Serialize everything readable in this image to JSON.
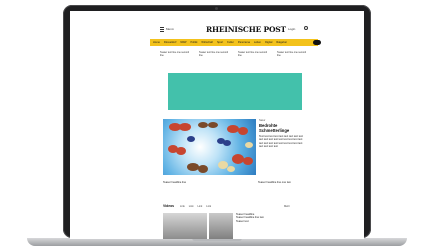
{
  "header": {
    "menu_label": "Menü",
    "logo": "RHEINISCHE POST",
    "login_label": "Login"
  },
  "nav": {
    "items": [
      "Home",
      "Düsseldorf",
      "NRW",
      "Politik",
      "Wirtschaft",
      "Sport",
      "Kultur",
      "Panorama",
      "Leben",
      "Digital",
      "Ratgeber"
    ]
  },
  "teasers": [
    "Teaser text line one second line",
    "Teaser text line one second line",
    "Teaser text line one second line",
    "Teaser text line one second line"
  ],
  "hero": {
    "kicker": "Natur",
    "title": "Bedrohte Schmetterlinge",
    "body": "Text text text text text text text text text text text text text text text text text text text text text text text text text text text text text text text"
  },
  "row_teasers": [
    "Teaser headline line",
    "Teaser headline line one two"
  ],
  "section": {
    "title": "Videos",
    "links": [
      "Link",
      "Link",
      "Link",
      "Link"
    ],
    "more": "Mehr"
  },
  "bottom_text": [
    "Teaser headline",
    "Teaser headline line two",
    "Teaser text"
  ],
  "colors": {
    "accent": "#f3c21b",
    "ad": "#43c1ab"
  }
}
